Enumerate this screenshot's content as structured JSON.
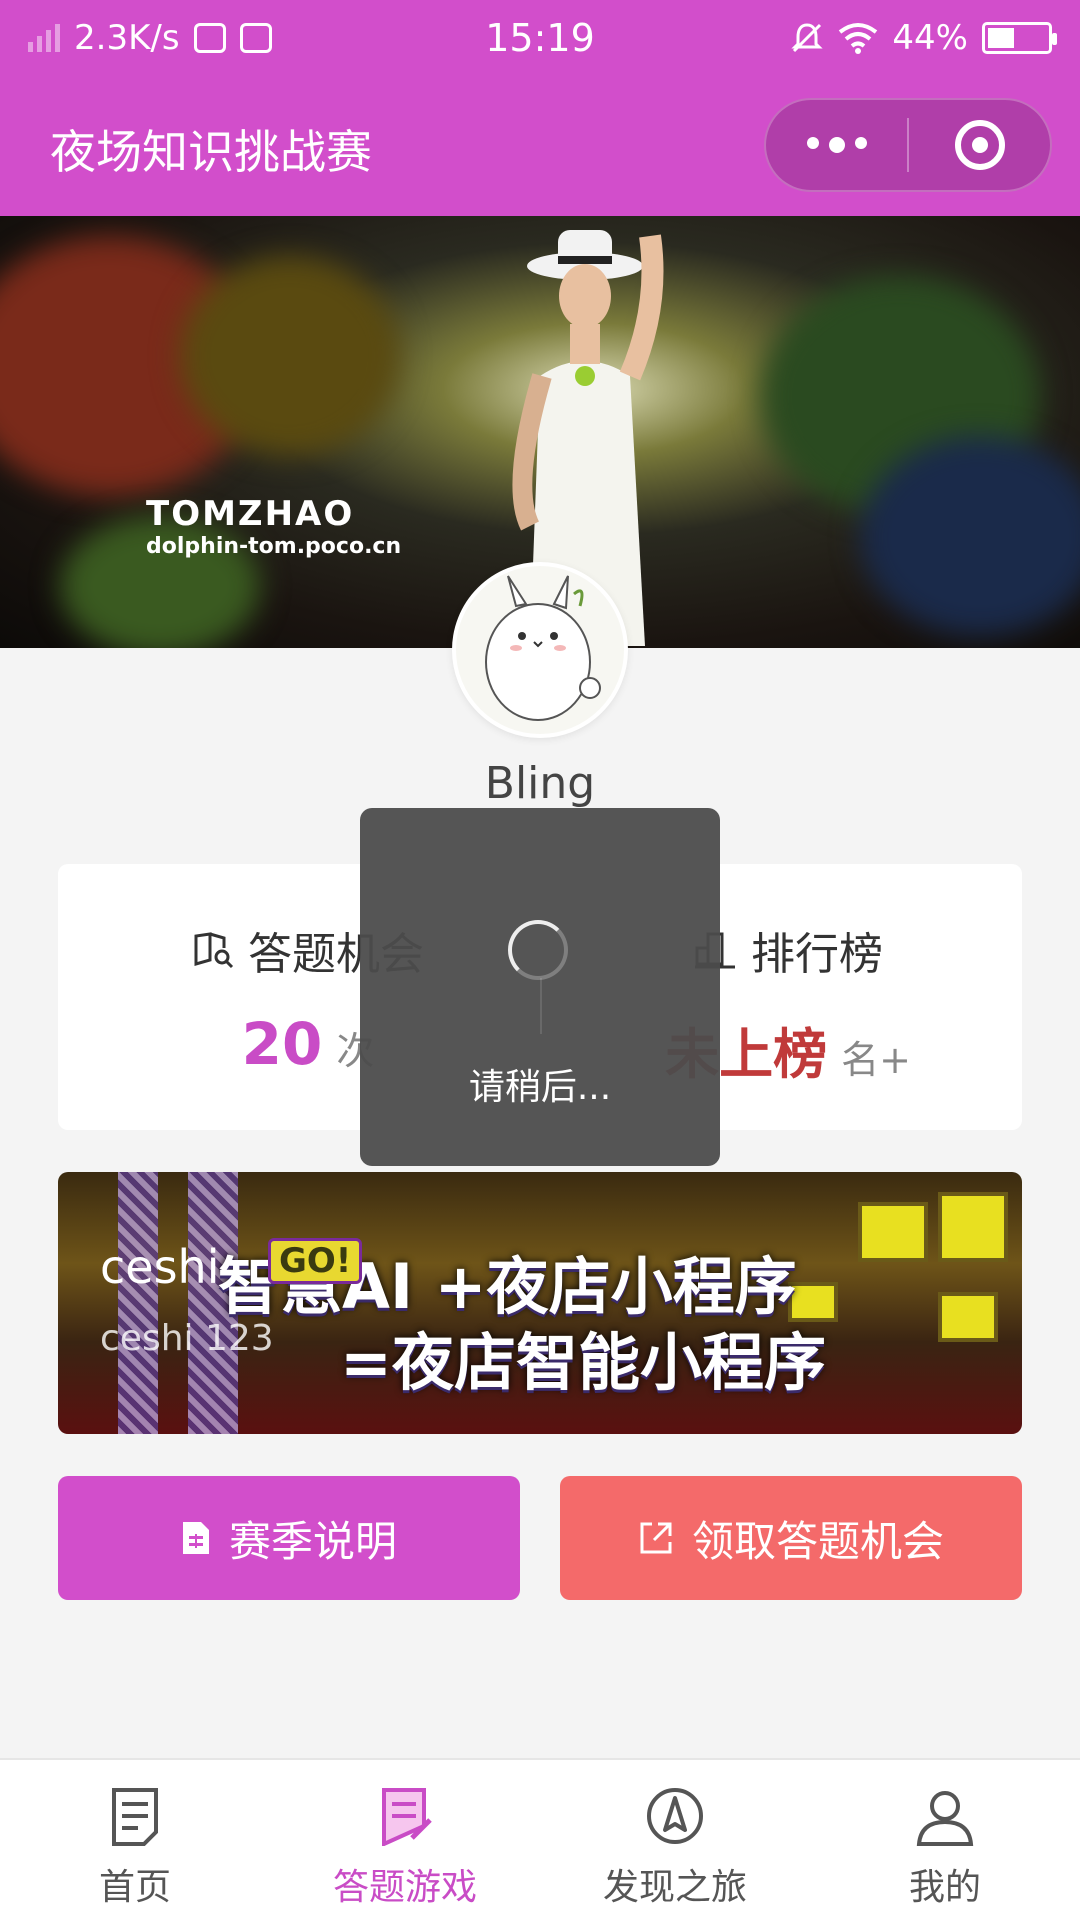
{
  "status_bar": {
    "speed": "2.3K/s",
    "time": "15:19",
    "battery": "44%",
    "battery_level": 0.44,
    "icons": [
      "signal-icon",
      "vivo-app-icon",
      "app-icon",
      "mute-icon",
      "wifi-icon",
      "battery-icon"
    ]
  },
  "title_bar": {
    "title": "夜场知识挑战赛",
    "icons": [
      "more-icon",
      "close-mini-program-icon"
    ]
  },
  "banner": {
    "watermark_title": "TOMZHAO",
    "watermark_url": "dolphin-tom.poco.cn"
  },
  "profile": {
    "username": "Bling"
  },
  "stats": {
    "chances_label": "答题机会",
    "chances_value": "20",
    "chances_unit": "次",
    "rank_label": "排行榜",
    "rank_value": "未上榜",
    "rank_unit": "名+",
    "icons": [
      "book-search-icon",
      "podium-icon"
    ]
  },
  "promo": {
    "badge": "GO!",
    "line1": "智慧AI +夜店小程序",
    "line2": "=夜店智能小程序",
    "caption_title": "ceshi",
    "caption_sub": "ceshi 123"
  },
  "buttons": {
    "season_label": "赛季说明",
    "get_chances_label": "领取答题机会",
    "icons": [
      "document-icon",
      "external-link-icon"
    ]
  },
  "loading": {
    "text": "请稍后..."
  },
  "tab_bar": {
    "items": [
      {
        "label": "首页",
        "icon": "home-doc-icon",
        "active": false
      },
      {
        "label": "答题游戏",
        "icon": "quiz-icon",
        "active": true
      },
      {
        "label": "发现之旅",
        "icon": "compass-icon",
        "active": false
      },
      {
        "label": "我的",
        "icon": "user-icon",
        "active": false
      }
    ]
  },
  "colors": {
    "primary": "#d24ecb",
    "accent": "#f46a6a",
    "rank": "#c03a3a",
    "count": "#c94cc6"
  }
}
